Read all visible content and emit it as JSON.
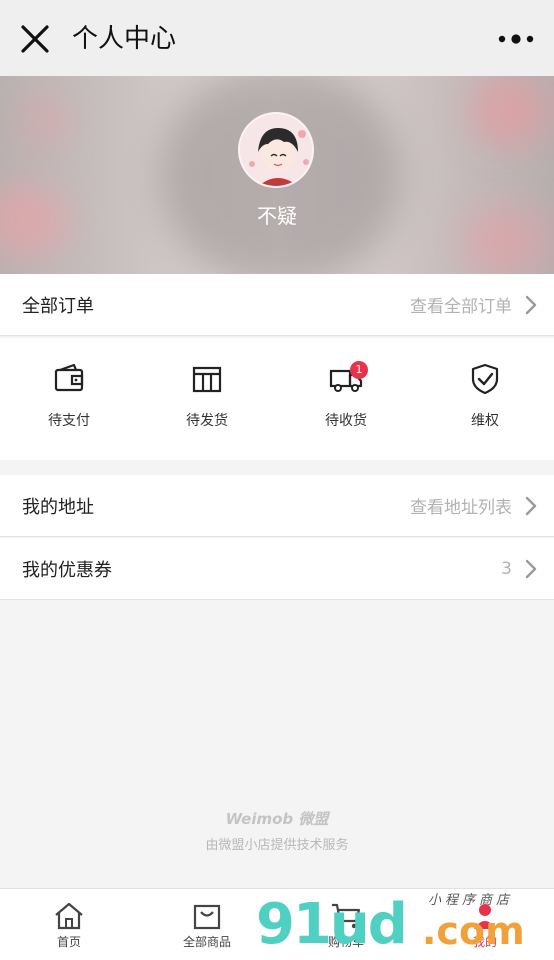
{
  "header": {
    "title": "个人中心"
  },
  "profile": {
    "username": "不疑"
  },
  "orders_row": {
    "label": "全部订单",
    "link": "查看全部订单"
  },
  "order_statuses": [
    {
      "label": "待支付",
      "icon": "wallet-icon"
    },
    {
      "label": "待发货",
      "icon": "box-icon"
    },
    {
      "label": "待收货",
      "icon": "truck-icon",
      "badge": "1"
    },
    {
      "label": "维权",
      "icon": "shield-check-icon"
    }
  ],
  "address_row": {
    "label": "我的地址",
    "link": "查看地址列表"
  },
  "coupon_row": {
    "label": "我的优惠券",
    "count": "3"
  },
  "footer": {
    "brand": "Weimob 微盟",
    "note": "由微盟小店提供技术服务"
  },
  "tabs": [
    {
      "label": "首页",
      "icon": "home-icon"
    },
    {
      "label": "全部商品",
      "icon": "bag-icon"
    },
    {
      "label": "购物车",
      "icon": "cart-icon"
    },
    {
      "label": "我的",
      "icon": "user-icon",
      "active": true
    }
  ],
  "watermark": {
    "numbers": "91ud",
    "domain": ".com",
    "tagline": "小程序商店"
  },
  "colors": {
    "accent": "#e8314a",
    "muted": "#b2b2b2"
  }
}
